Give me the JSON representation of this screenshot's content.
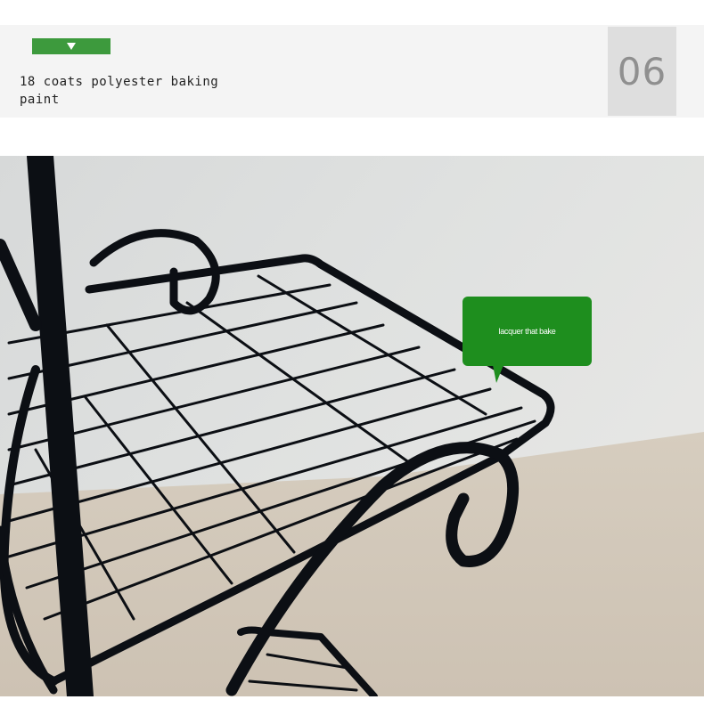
{
  "header": {
    "caption": "18 coats polyester baking paint",
    "number": "06",
    "tag_icon": "triangle-down-icon",
    "accent_color": "#3d9a3d"
  },
  "photo": {
    "subject": "product-photo",
    "callout_text": "lacquer that bake",
    "callout_color": "#1e8e1e"
  }
}
